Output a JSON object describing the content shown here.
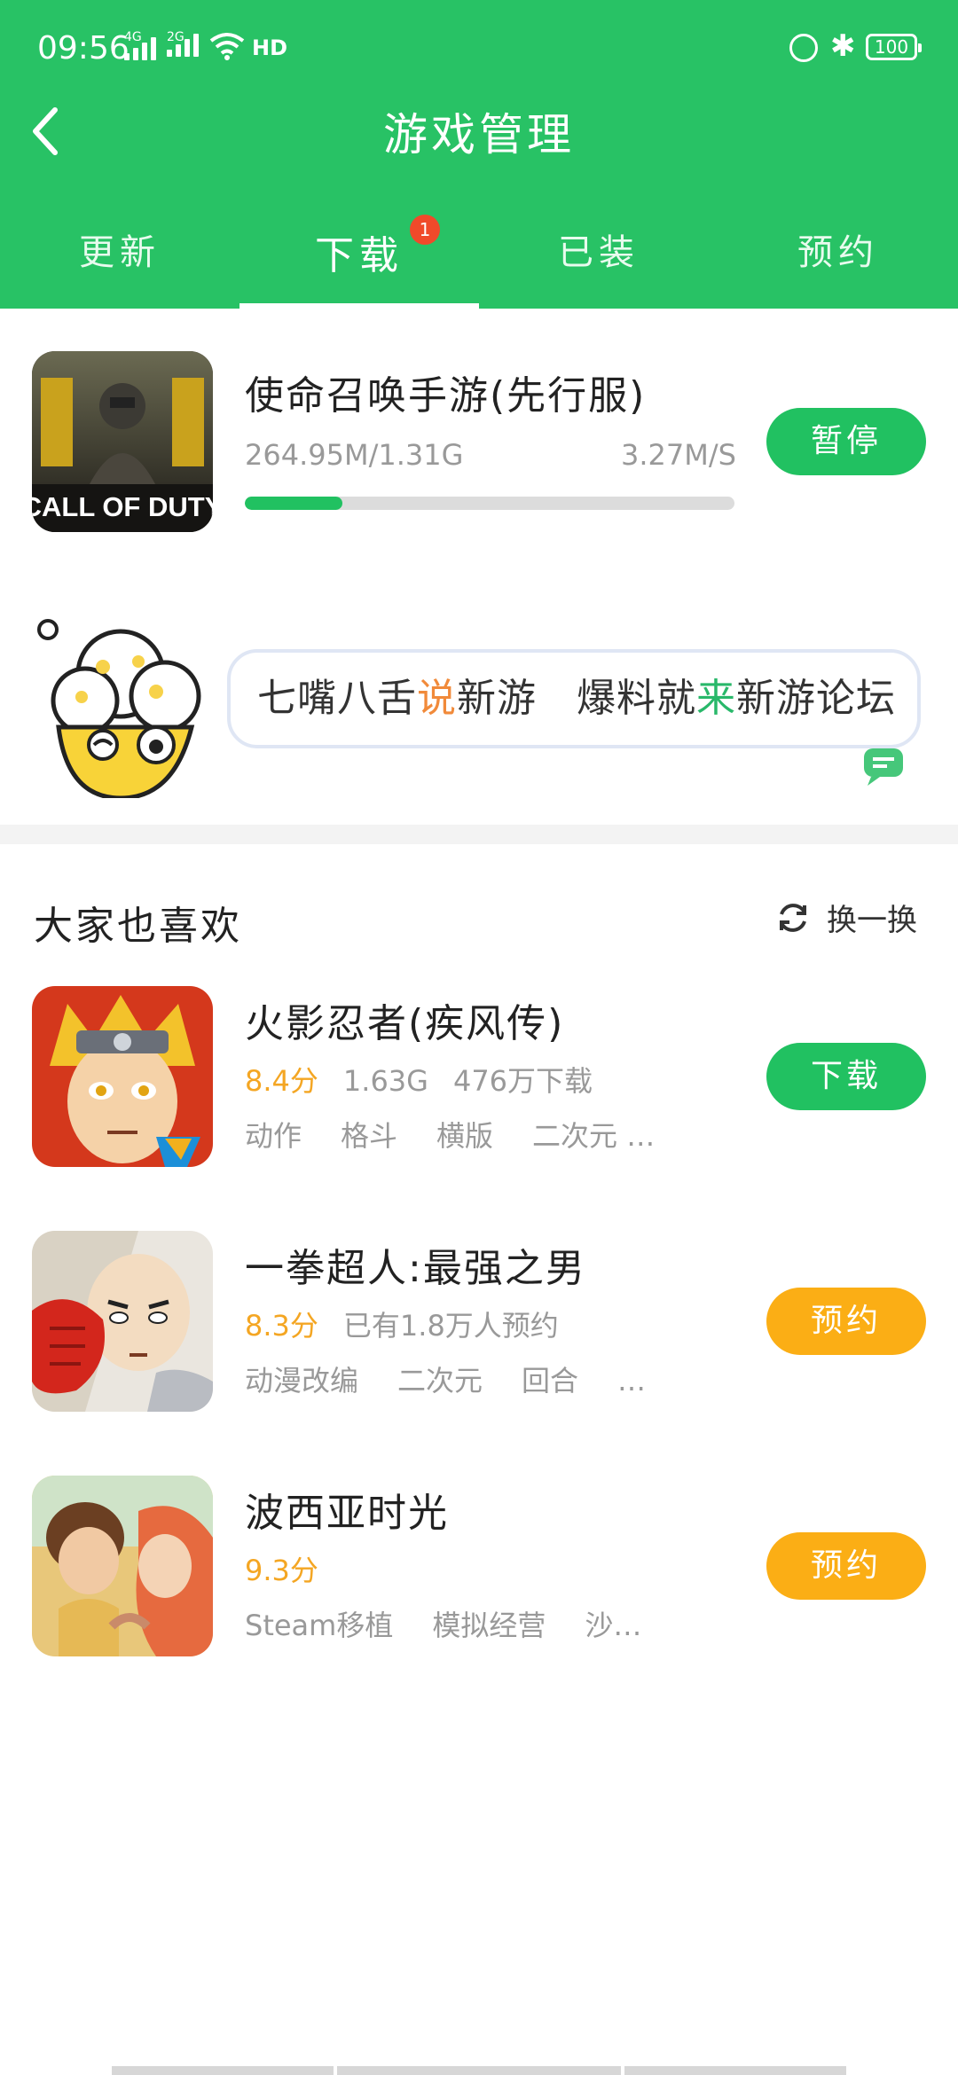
{
  "status_bar": {
    "time": "09:56",
    "network_1": "4G",
    "network_2": "2G",
    "hd": "HD",
    "battery": "100"
  },
  "header": {
    "title": "游戏管理"
  },
  "tabs": [
    {
      "label": "更新"
    },
    {
      "label": "下载",
      "badge": "1"
    },
    {
      "label": "已装"
    },
    {
      "label": "预约"
    }
  ],
  "downloading": {
    "name": "使命召唤手游(先行服)",
    "icon": "call-of-duty-game-icon",
    "icon_text": "CALL OF DUTY",
    "progress_text": "264.95M/1.31G",
    "speed": "3.27M/S",
    "progress_fraction": 0.2,
    "button": "暂停"
  },
  "banner": {
    "part1": "七嘴八舌",
    "part2": "说",
    "part3": "新游",
    "part4": "爆料就",
    "part5": "来",
    "part6": "新游论坛"
  },
  "recommend": {
    "title": "大家也喜欢",
    "refresh_label": "换一换",
    "items": [
      {
        "name": "火影忍者(疾风传)",
        "icon": "naruto-game-icon",
        "rating": "8.4分",
        "size": "1.63G",
        "downloads": "476万下载",
        "tags": [
          "动作",
          "格斗",
          "横版",
          "二次元 …"
        ],
        "button": "下载",
        "button_color": "#21c161"
      },
      {
        "name": "一拳超人:最强之男",
        "icon": "one-punch-man-game-icon",
        "rating": "8.3分",
        "reservations": "已有1.8万人预约",
        "tags": [
          "动漫改编",
          "二次元",
          "回合",
          "…"
        ],
        "button": "预约",
        "button_color": "#fbae15"
      },
      {
        "name": "波西亚时光",
        "icon": "portia-game-icon",
        "rating": "9.3分",
        "tags": [
          "Steam移植",
          "模拟经营",
          "沙…"
        ],
        "button": "预约",
        "button_color": "#fbae15"
      }
    ]
  },
  "colors": {
    "brand_green": "#28c265",
    "button_green": "#21c161",
    "reserve_orange": "#fbae15",
    "badge_red": "#f04a2a",
    "rating_orange": "#f4a623"
  }
}
